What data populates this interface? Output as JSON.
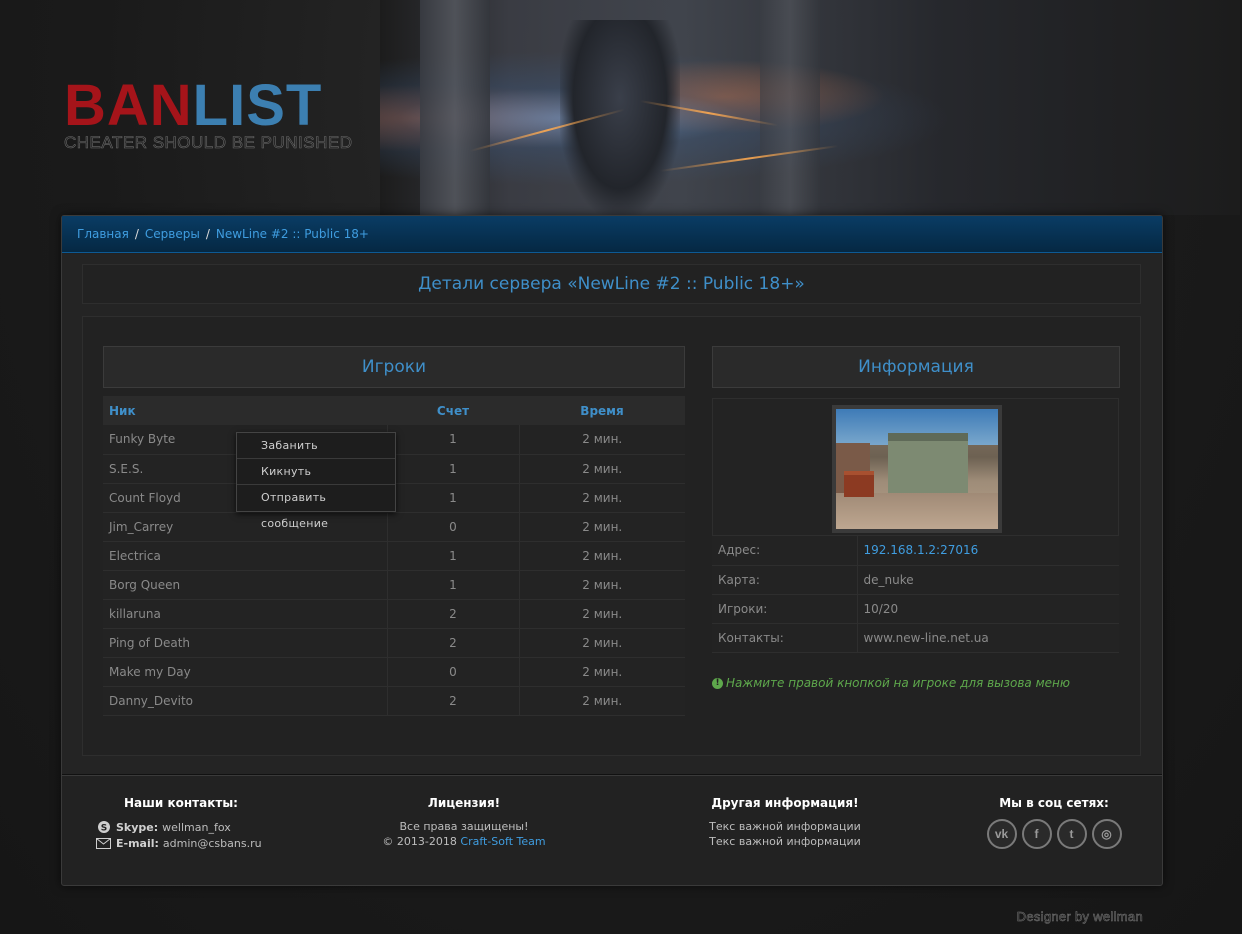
{
  "logo": {
    "part1": "BAN",
    "part2": "LIST",
    "tagline": "CHEATER SHOULD BE PUNISHED"
  },
  "breadcrumb": {
    "items": [
      "Главная",
      "Серверы"
    ],
    "separator": "/",
    "current": "NewLine #2 :: Public 18+"
  },
  "page_title": "Детали сервера «NewLine #2 :: Public 18+»",
  "players": {
    "title": "Игроки",
    "columns": [
      "Ник",
      "Счет",
      "Время"
    ],
    "rows": [
      {
        "nick": "Funky Byte",
        "score": "1",
        "time": "2 мин."
      },
      {
        "nick": "S.E.S.",
        "score": "1",
        "time": "2 мин."
      },
      {
        "nick": "Count Floyd",
        "score": "1",
        "time": "2 мин."
      },
      {
        "nick": "Jim_Carrey",
        "score": "0",
        "time": "2 мин."
      },
      {
        "nick": "Electrica",
        "score": "1",
        "time": "2 мин."
      },
      {
        "nick": "Borg Queen",
        "score": "1",
        "time": "2 мин."
      },
      {
        "nick": "killaruna",
        "score": "2",
        "time": "2 мин."
      },
      {
        "nick": "Ping of Death",
        "score": "2",
        "time": "2 мин."
      },
      {
        "nick": "Make my Day",
        "score": "0",
        "time": "2 мин."
      },
      {
        "nick": "Danny_Devito",
        "score": "2",
        "time": "2 мин."
      }
    ]
  },
  "context_menu": {
    "items": [
      "Забанить",
      "Кикнуть",
      "Отправить сообщение"
    ]
  },
  "info": {
    "title": "Информация",
    "rows": [
      {
        "key": "Адрес:",
        "value": "192.168.1.2:27016"
      },
      {
        "key": "Карта:",
        "value": "de_nuke"
      },
      {
        "key": "Игроки:",
        "value": "10/20"
      },
      {
        "key": "Контакты:",
        "value": "www.new-line.net.ua"
      }
    ],
    "hint": "Нажмите правой кнопкой на игроке для вызова меню"
  },
  "footer": {
    "contacts": {
      "title": "Наши контакты:",
      "skype_label": "Skype:",
      "skype_value": "wellman_fox",
      "email_label": "E-mail:",
      "email_value": "admin@csbans.ru"
    },
    "license": {
      "title": "Лицензия!",
      "line1": "Все права защищены!",
      "line2_prefix": "© 2013-2018",
      "line2_link": "Craft-Soft Team"
    },
    "other": {
      "title": "Другая информация!",
      "line1": "Текс важной информации",
      "line2": "Текс важной информации"
    },
    "social": {
      "title": "Мы в соц сетях:",
      "icons": [
        "vk-icon",
        "facebook-icon",
        "twitter-icon",
        "instagram-icon"
      ],
      "glyphs": [
        "vk",
        "f",
        "t",
        "◎"
      ]
    }
  },
  "designer": "Designer by wellman",
  "colors": {
    "accent": "#3f8fc9",
    "link": "#3f9de0",
    "logo_red": "#a5141a",
    "logo_blue": "#3c7fb1",
    "hint_green": "#5ea84c",
    "breadcrumb_bg": "#0a3c64"
  }
}
